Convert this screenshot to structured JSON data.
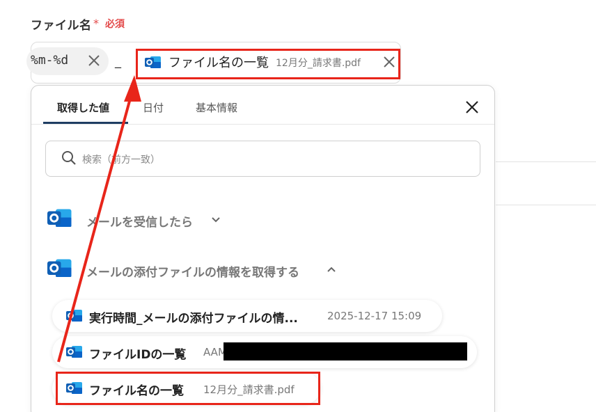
{
  "field": {
    "label": "ファイル名",
    "required_star": "*",
    "required_text": "必須"
  },
  "input": {
    "date_chip": "%m-%d",
    "separator": "_",
    "file_chip_label": "ファイル名の一覧",
    "file_chip_value": "12月分_請求書.pdf"
  },
  "tabs": [
    {
      "label": "取得した値",
      "active": true
    },
    {
      "label": "日付",
      "active": false
    },
    {
      "label": "基本情報",
      "active": false
    }
  ],
  "search": {
    "placeholder": "検索（前方一致）"
  },
  "groups": [
    {
      "label": "メールを受信したら",
      "expanded": false
    },
    {
      "label": "メールの添付ファイルの情報を取得する",
      "expanded": true
    }
  ],
  "items": [
    {
      "label": "実行時間_メールの添付ファイルの情...",
      "value": "2025-12-17 15:09"
    },
    {
      "label": "ファイルIDの一覧",
      "value": "AAM"
    },
    {
      "label": "ファイル名の一覧",
      "value": "12月分_請求書.pdf"
    }
  ],
  "colors": {
    "highlight": "#e8251a",
    "tab_underline": "#1f3e63",
    "outlook_blue": "#0a64c8"
  },
  "icons": [
    "outlook-icon",
    "close-icon",
    "search-icon",
    "chevron-down-icon",
    "chevron-up-icon",
    "arrow-annotation"
  ]
}
